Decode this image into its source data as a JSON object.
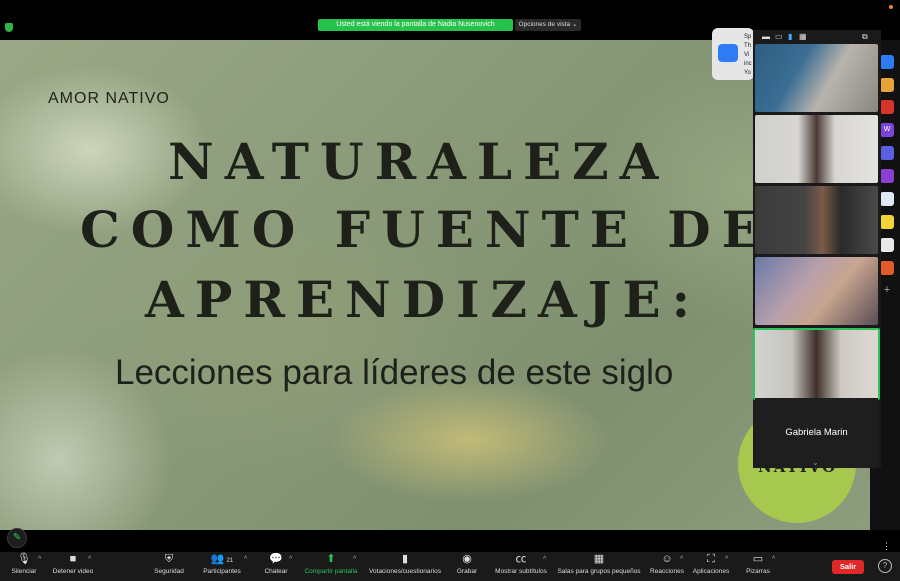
{
  "meeting": {
    "sharing_banner": "Usted está viendo la pantalla de Nadia Nusenovich",
    "view_options": "Opciones de vista",
    "participant_count": "21"
  },
  "slide": {
    "brand": "AMOR NATIVO",
    "title_line1": "NATURALEZA",
    "title_line2": "COMO FUENTE DE",
    "title_line3": "APRENDIZAJE:",
    "subtitle": "Lecciones para líderes de este siglo",
    "logo_text": "NATIVO",
    "logo_color": "#a6c84f"
  },
  "notification": {
    "lines": [
      "Sp",
      "Th",
      "Vi",
      "inc",
      "Yo"
    ]
  },
  "gallery": {
    "tiles": [
      {
        "name": "participant-video"
      },
      {
        "name": "participant-video"
      },
      {
        "name": "participant-video"
      },
      {
        "name": "participant-video"
      },
      {
        "name": "participant-video",
        "active": true
      }
    ],
    "name_tile": "Gabriela Marin"
  },
  "toolbar": {
    "mute": "Silenciar",
    "stop_video": "Detener video",
    "security": "Seguridad",
    "participants": "Participantes",
    "chat": "Chatear",
    "share": "Compartir pantalla",
    "polls": "Votaciones/cuestionarios",
    "record": "Grabar",
    "subtitles": "Mostrar subtítulos",
    "breakout": "Salas para grupos pequeños",
    "reactions": "Reacciones",
    "apps": "Aplicaciones",
    "whiteboards": "Pizarras",
    "leave": "Salir"
  },
  "colors": {
    "accent_green": "#2ec25a",
    "leave_red": "#e02828"
  }
}
